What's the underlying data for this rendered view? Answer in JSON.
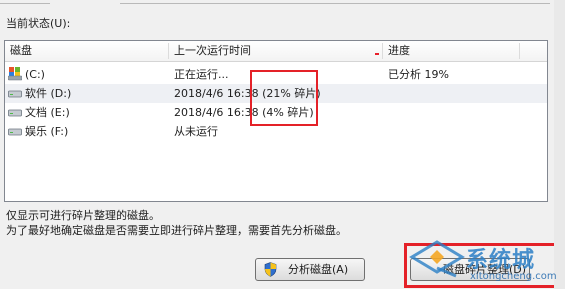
{
  "section_label": "当前状态(U):",
  "table": {
    "columns": [
      "磁盘",
      "上一次运行时间",
      "进度"
    ],
    "rows": [
      {
        "disk": "(C:)",
        "last_run": "正在运行...",
        "progress": "已分析 19%"
      },
      {
        "disk": "软件 (D:)",
        "last_run": "2018/4/6 16:38 (21% 碎片)",
        "progress": ""
      },
      {
        "disk": "文档 (E:)",
        "last_run": "2018/4/6 16:38 (4% 碎片)",
        "progress": ""
      },
      {
        "disk": "娱乐 (F:)",
        "last_run": "从未运行",
        "progress": ""
      }
    ]
  },
  "notes": [
    "仅显示可进行碎片整理的磁盘。",
    "为了最好地确定磁盘是否需要立即进行碎片整理，需要首先分析磁盘。"
  ],
  "buttons": {
    "analyze": "分析磁盘(A)",
    "defrag": "磁盘碎片整理(D)"
  },
  "watermark": {
    "title": "系统城",
    "url": "xitongcheng.com"
  },
  "colors": {
    "highlight": "#e42128",
    "watermark": "#2b7fc6"
  }
}
